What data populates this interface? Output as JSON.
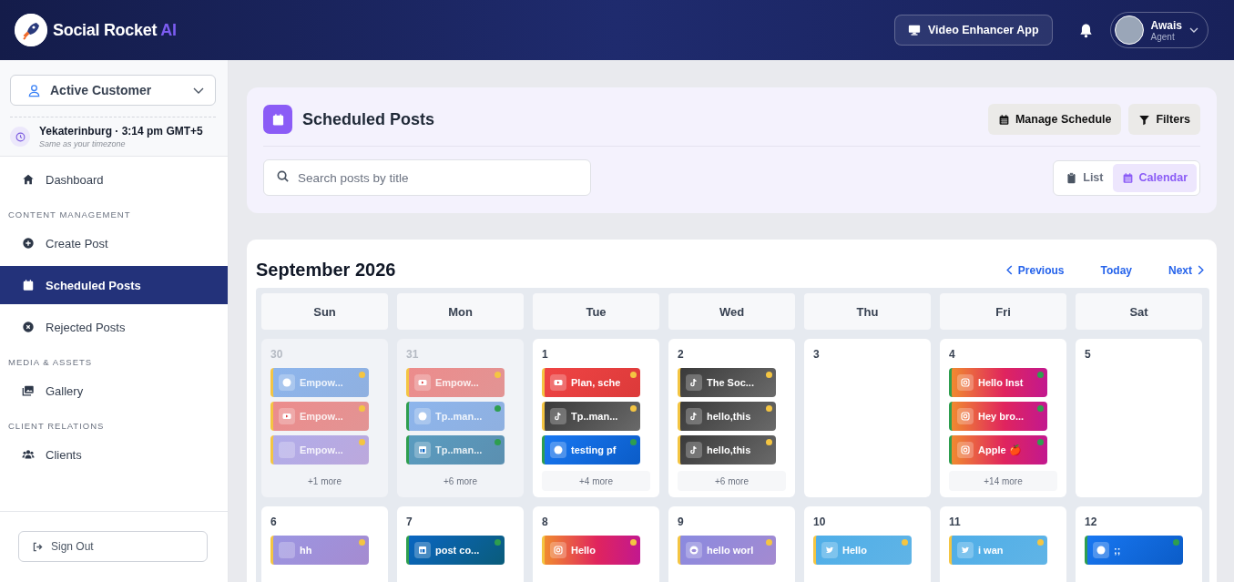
{
  "header": {
    "brand": "Social Rocket",
    "brand_accent": "AI",
    "app_button": "Video Enhancer App",
    "user": {
      "name": "Awais",
      "role": "Agent"
    }
  },
  "sidebar": {
    "customer_select": "Active Customer",
    "timezone": {
      "line": "Yekaterinburg · 3:14 pm GMT+5",
      "note": "Same as your timezone"
    },
    "nav": [
      {
        "kind": "link",
        "label": "Dashboard",
        "selected": false
      },
      {
        "kind": "section",
        "label": "CONTENT MANAGEMENT"
      },
      {
        "kind": "link",
        "label": "Create Post",
        "selected": false
      },
      {
        "kind": "link",
        "label": "Scheduled Posts",
        "selected": true
      },
      {
        "kind": "link",
        "label": "Rejected Posts",
        "selected": false
      },
      {
        "kind": "section",
        "label": "MEDIA & ASSETS"
      },
      {
        "kind": "link",
        "label": "Gallery",
        "selected": false
      },
      {
        "kind": "section",
        "label": "CLIENT RELATIONS"
      },
      {
        "kind": "link",
        "label": "Clients",
        "selected": false
      }
    ],
    "sign_out": "Sign Out"
  },
  "page": {
    "title": "Scheduled Posts",
    "actions": [
      "Manage Schedule",
      "Filters"
    ],
    "search": {
      "placeholder": "Search posts by title"
    },
    "views": [
      {
        "label": "List",
        "selected": false
      },
      {
        "label": "Calendar",
        "selected": true
      }
    ]
  },
  "calendar": {
    "title": "September 2026",
    "previous": "Previous",
    "today": "Today",
    "next": "Next",
    "weekdays": [
      "Sun",
      "Mon",
      "Tue",
      "Wed",
      "Thu",
      "Fri",
      "Sat"
    ],
    "weeks": [
      [
        {
          "day": "30",
          "outside": true,
          "posts": [
            {
              "kind": "facebook",
              "title": "Empow...",
              "color": "#f4c542"
            },
            {
              "kind": "youtube",
              "title": "Empow...",
              "color": "#f4c542"
            },
            {
              "kind": "other",
              "title": "Empow...",
              "color": "#f4c542"
            }
          ],
          "more": "+1 more"
        },
        {
          "day": "31",
          "outside": true,
          "posts": [
            {
              "kind": "youtube",
              "title": "Empow...",
              "color": "#f4c542"
            },
            {
              "kind": "facebook",
              "title": "Tp..man...",
              "color": "#2e9e4f"
            },
            {
              "kind": "linkedin",
              "title": "Tp..man...",
              "color": "#2e9e4f"
            }
          ],
          "more": "+6 more"
        },
        {
          "day": "1",
          "outside": false,
          "posts": [
            {
              "kind": "youtube",
              "title": "Plan, sche",
              "color": "#f4c542"
            },
            {
              "kind": "tiktok",
              "title": "Tp..man...",
              "color": "#f4c542"
            },
            {
              "kind": "facebook",
              "title": "testing pf",
              "color": "#2e9e4f"
            }
          ],
          "more": "+4 more"
        },
        {
          "day": "2",
          "outside": false,
          "posts": [
            {
              "kind": "tiktok",
              "title": "The Soc...",
              "color": "#f4c542"
            },
            {
              "kind": "tiktok",
              "title": "hello,this",
              "color": "#f4c542"
            },
            {
              "kind": "tiktok",
              "title": "hello,this",
              "color": "#f4c542"
            }
          ],
          "more": "+6 more"
        },
        {
          "day": "3",
          "outside": false
        },
        {
          "day": "4",
          "outside": false,
          "posts": [
            {
              "kind": "instagram",
              "title": "Hello Inst",
              "color": "#2e9e4f"
            },
            {
              "kind": "instagram",
              "title": "Hey bro...",
              "color": "#2e9e4f"
            },
            {
              "kind": "instagram",
              "title": "Apple 🍎",
              "color": "#2e9e4f"
            }
          ],
          "more": "+14 more"
        },
        {
          "day": "5",
          "outside": false
        }
      ],
      [
        {
          "day": "6",
          "outside": false,
          "posts": [
            {
              "kind": "other",
              "title": "hh",
              "color": "#f4c542"
            }
          ]
        },
        {
          "day": "7",
          "outside": false,
          "posts": [
            {
              "kind": "linkedin",
              "title": "post co...",
              "color": "#2e9e4f"
            }
          ]
        },
        {
          "day": "8",
          "outside": false,
          "posts": [
            {
              "kind": "instagram",
              "title": "Hello",
              "color": "#f4c542"
            }
          ]
        },
        {
          "day": "9",
          "outside": false,
          "posts": [
            {
              "kind": "reddit",
              "title": "hello worl",
              "color": "#f4c542"
            }
          ]
        },
        {
          "day": "10",
          "outside": false,
          "posts": [
            {
              "kind": "twitter",
              "title": "Hello",
              "color": "#f4c542"
            }
          ]
        },
        {
          "day": "11",
          "outside": false,
          "posts": [
            {
              "kind": "twitter",
              "title": "i wan",
              "color": "#f4c542"
            }
          ]
        },
        {
          "day": "12",
          "outside": false,
          "posts": [
            {
              "kind": "facebook",
              "title": ";;",
              "color": "#2e9e4f"
            }
          ]
        }
      ]
    ]
  }
}
